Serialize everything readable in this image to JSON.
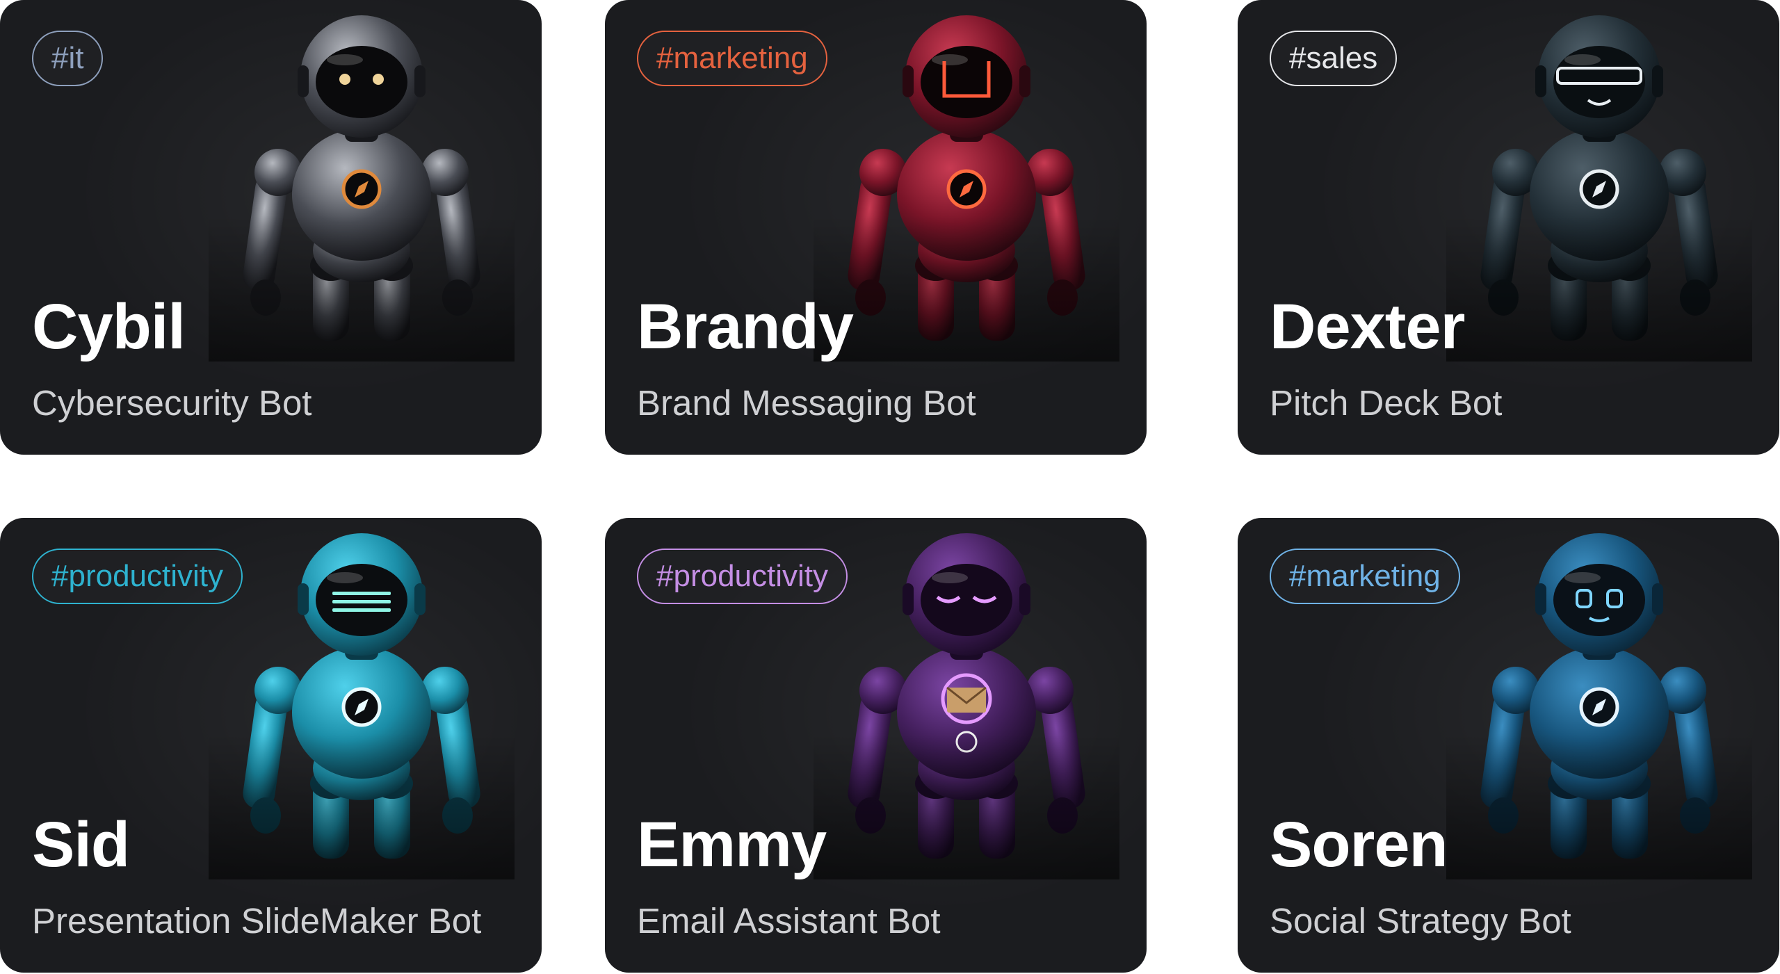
{
  "cards": [
    {
      "tag": "#it",
      "name": "Cybil",
      "role": "Cybersecurity Bot",
      "colors": {
        "tag": "#8ea0bd",
        "body": "#4a4d55",
        "light": "#b5b8bf",
        "dark": "#17181c",
        "visor": "#0a0a0c",
        "glow": "#f0d49a",
        "accent": "#e08a3c"
      },
      "icons": {
        "badge": "compass-icon",
        "visor": "dot-eyes"
      }
    },
    {
      "tag": "#marketing",
      "name": "Brandy",
      "role": "Brand Messaging Bot",
      "colors": {
        "tag": "#e5623f",
        "body": "#7a1428",
        "light": "#c73a52",
        "dark": "#2a0810",
        "visor": "#0b0506",
        "glow": "#ff5a3a",
        "accent": "#ff6a3f"
      },
      "icons": {
        "badge": "compass-icon",
        "visor": "u-glow"
      }
    },
    {
      "tag": "#sales",
      "name": "Dexter",
      "role": "Pitch Deck Bot",
      "colors": {
        "tag": "#e6e7ea",
        "body": "#233038",
        "light": "#4e5e68",
        "dark": "#0c1216",
        "visor": "#0a0f12",
        "glow": "#e8eef2",
        "accent": "#e8eef2"
      },
      "icons": {
        "badge": "compass-icon",
        "visor": "band"
      }
    },
    {
      "tag": "#productivity",
      "name": "Sid",
      "role": "Presentation SlideMaker Bot",
      "colors": {
        "tag": "#2eb2cf",
        "body": "#1b8ea8",
        "light": "#4fd0ea",
        "dark": "#0a3a48",
        "visor": "#0b0d10",
        "glow": "#8ff5e6",
        "accent": "#e8fbff"
      },
      "icons": {
        "badge": "compass-icon",
        "visor": "lines"
      }
    },
    {
      "tag": "#productivity",
      "name": "Emmy",
      "role": "Email Assistant Bot",
      "colors": {
        "tag": "#c48ee4",
        "body": "#45205f",
        "light": "#7b45a3",
        "dark": "#1a0a26",
        "visor": "#14081c",
        "glow": "#e59bff",
        "accent": "#c99e6a"
      },
      "icons": {
        "badge": "envelope-icon",
        "visor": "closed-eyes"
      }
    },
    {
      "tag": "#marketing",
      "name": "Soren",
      "role": "Social Strategy Bot",
      "colors": {
        "tag": "#6fb2e6",
        "body": "#17557d",
        "light": "#3b8dc0",
        "dark": "#0a2638",
        "visor": "#0a1118",
        "glow": "#7fd6ff",
        "accent": "#e6f4ff"
      },
      "icons": {
        "badge": "compass-icon",
        "visor": "square-eyes"
      }
    }
  ]
}
